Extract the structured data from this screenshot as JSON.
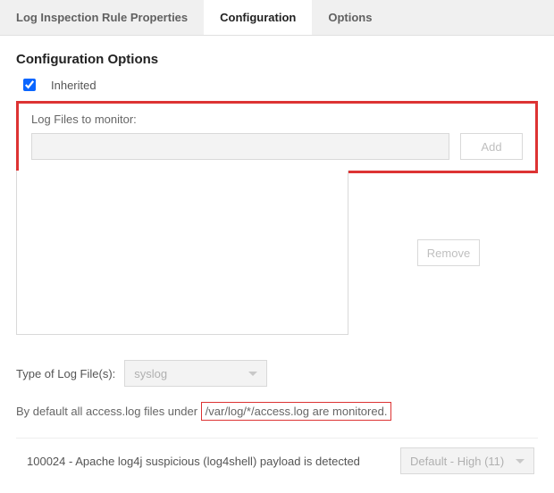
{
  "tabs": {
    "properties": "Log Inspection Rule Properties",
    "configuration": "Configuration",
    "options": "Options"
  },
  "config": {
    "title": "Configuration Options",
    "inherited_label": "Inherited",
    "inherited_checked": true,
    "log_files_label": "Log Files to monitor:",
    "log_file_input": "",
    "add_label": "Add",
    "remove_label": "Remove",
    "type_label": "Type of Log File(s):",
    "type_value": "syslog",
    "default_prefix": "By default all access.log files under ",
    "default_highlight": "/var/log/*/access.log are monitored."
  },
  "rule": {
    "text": "100024 - Apache log4j suspicious (log4shell) payload is detected",
    "severity": "Default - High (11)"
  }
}
